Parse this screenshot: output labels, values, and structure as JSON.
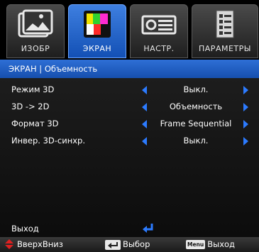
{
  "tabs": [
    {
      "label": "ИЗОБР",
      "icon": "picture-icon",
      "active": false
    },
    {
      "label": "ЭКРАН",
      "icon": "screen-icon",
      "active": true
    },
    {
      "label": "НАСТР.",
      "icon": "projector-settings-icon",
      "active": false
    },
    {
      "label": "ПАРАМЕТРЫ",
      "icon": "options-document-icon",
      "active": false
    }
  ],
  "breadcrumb": "ЭКРАН  |  Объемность",
  "rows": [
    {
      "label": "Режим 3D",
      "value": "Выкл."
    },
    {
      "label": "3D -> 2D",
      "value": "Объемность"
    },
    {
      "label": "Формат 3D",
      "value": "Frame Sequential"
    },
    {
      "label": "Инвер. 3D-синхр.",
      "value": "Выкл."
    }
  ],
  "exit": {
    "label": "Выход",
    "icon": "enter-arrow-icon"
  },
  "help": {
    "updown": "ВверхВниз",
    "select": "Выбор",
    "menu_key": "Menu",
    "exit": "Выход"
  },
  "colors": {
    "accent": "#1f5fc9",
    "arrow": "#2c7bff"
  }
}
